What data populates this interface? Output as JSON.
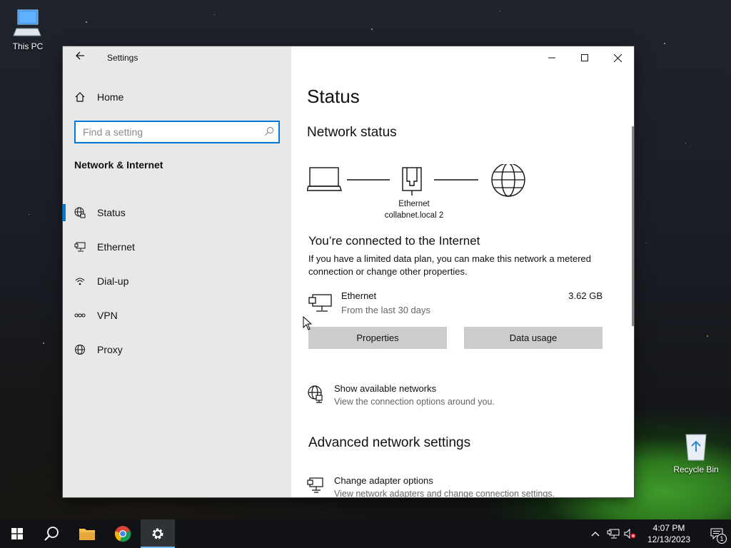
{
  "desktop": {
    "this_pc_label": "This PC",
    "recycle_bin_label": "Recycle Bin"
  },
  "window": {
    "title": "Settings",
    "controls": [
      "minimize",
      "maximize",
      "close"
    ]
  },
  "sidebar": {
    "home_label": "Home",
    "search_placeholder": "Find a setting",
    "section_title": "Network & Internet",
    "items": [
      {
        "label": "Status",
        "icon": "status-globe-icon",
        "active": true
      },
      {
        "label": "Ethernet",
        "icon": "ethernet-icon",
        "active": false
      },
      {
        "label": "Dial-up",
        "icon": "dialup-icon",
        "active": false
      },
      {
        "label": "VPN",
        "icon": "vpn-icon",
        "active": false
      },
      {
        "label": "Proxy",
        "icon": "proxy-globe-icon",
        "active": false
      }
    ]
  },
  "main": {
    "title": "Status",
    "network_status_heading": "Network status",
    "diagram_label_line1": "Ethernet",
    "diagram_label_line2": "collabnet.local 2",
    "connected_title": "You’re connected to the Internet",
    "connected_desc": "If you have a limited data plan, you can make this network a metered connection or change other properties.",
    "ethernet": {
      "name": "Ethernet",
      "subtitle": "From the last 30 days",
      "usage": "3.62 GB"
    },
    "buttons": {
      "properties": "Properties",
      "data_usage": "Data usage"
    },
    "show_networks": {
      "title": "Show available networks",
      "subtitle": "View the connection options around you."
    },
    "advanced_heading": "Advanced network settings",
    "change_adapter": {
      "title": "Change adapter options",
      "subtitle": "View network adapters and change connection settings."
    }
  },
  "taskbar": {
    "time": "4:07 PM",
    "date": "12/13/2023",
    "notification_count": "1",
    "apps": [
      "start-icon",
      "search-icon",
      "file-explorer-icon",
      "chrome-icon",
      "settings-gear-icon"
    ]
  },
  "colors": {
    "accent": "#0078d7",
    "sidebar_bg": "#e8e8e8",
    "button_bg": "#cccccc"
  }
}
